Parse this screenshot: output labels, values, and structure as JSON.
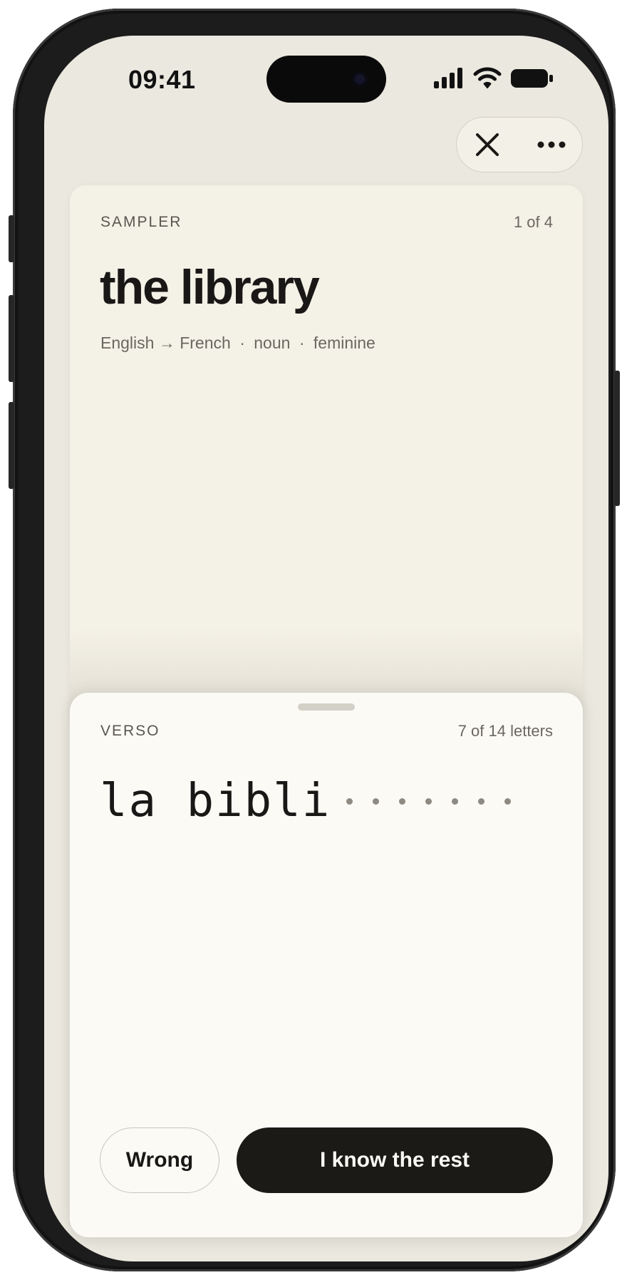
{
  "status_bar": {
    "time": "09:41",
    "icons": [
      "cellular-signal-icon",
      "wifi-icon",
      "battery-icon"
    ]
  },
  "top_controls": {
    "icons": [
      "close-icon",
      "more-icon"
    ]
  },
  "front_card": {
    "deck_label": "SAMPLER",
    "counter": "1 of 4",
    "word": "the library",
    "meta": {
      "source_language": "English",
      "arrow": "→",
      "target_language": "French",
      "part_of_speech": "noun",
      "gender": "feminine",
      "separator": "·"
    }
  },
  "back_sheet": {
    "label": "VERSO",
    "progress_text": "7 of 14 letters",
    "revealed": "la bibli",
    "hidden_count": 7,
    "letters_revealed": 7,
    "letters_total": 14
  },
  "actions": {
    "wrong_label": "Wrong",
    "know_label": "I know the rest"
  },
  "colors": {
    "screen_bg": "#ebe8df",
    "card_bg": "#f4f1e7",
    "sheet_bg": "#fbfaf5",
    "primary_button": "#1c1a17",
    "text_primary": "#1a1816",
    "text_muted": "#6b6760"
  }
}
